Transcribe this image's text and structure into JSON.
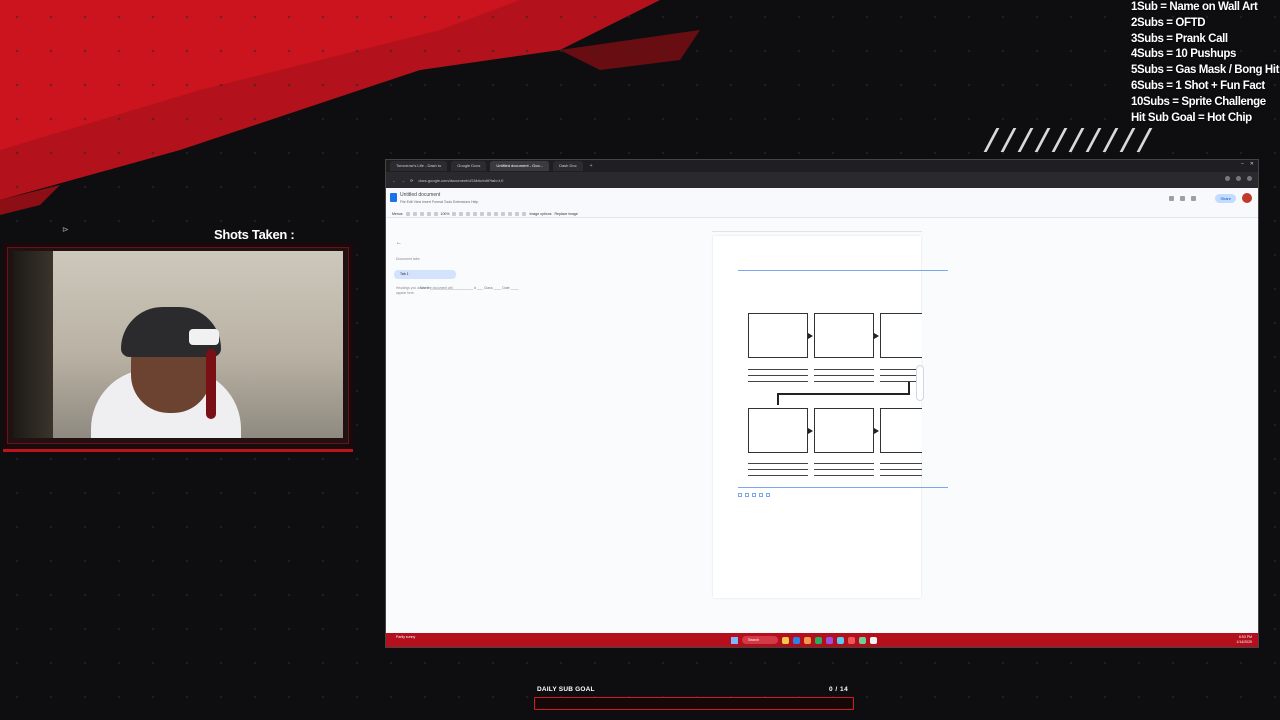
{
  "sub_goals": [
    "1Sub = Name on Wall Art",
    "2Subs = OFTD",
    "3Subs = Prank Call",
    "4Subs = 10 Pushups",
    "5Subs = Gas Mask / Bong Hit",
    "6Subs = 1 Shot + Fun Fact",
    "10Subs =  Sprite Challenge",
    "Hit Sub Goal  = Hot Chip"
  ],
  "webcam": {
    "shots_label": "Shots Taken :"
  },
  "browser": {
    "tabs": [
      {
        "label": "Tomorrow's Life - Dash to",
        "active": false
      },
      {
        "label": "Google Docs",
        "active": false
      },
      {
        "label": "Untitled document - Goo...",
        "active": true
      },
      {
        "label": "Dash Doc",
        "active": false
      }
    ],
    "url": "docs.google.com/document/d/1Mxk/edit?tab=t.0"
  },
  "doc": {
    "title": "Untitled document",
    "menus": "File  Edit  View  Insert  Format  Tools  Extensions  Help",
    "toolbar_menus": "Menus",
    "toolbar_zoom": "100%",
    "image_options": "Image options",
    "replace_image": "Replace image",
    "share_label": "Share",
    "outline_back": "←",
    "outline_title": "Document tabs",
    "outline_tab": "Tab 1",
    "outline_note": "Headings you add to the document will appear here.",
    "name_line": "Name ______________________  # ___  Class ____  Date ____"
  },
  "taskbar": {
    "weather": "Partly sunny",
    "search": "Search",
    "clock_time": "6:53 PM",
    "clock_date": "1/14/2025"
  },
  "sub_goal_bar": {
    "label": "DAILY SUB GOAL",
    "count": "0 / 14",
    "current": 0,
    "target": 14
  },
  "colors": {
    "accent_red": "#d21826",
    "taskbar_red": "#b30f1c"
  }
}
